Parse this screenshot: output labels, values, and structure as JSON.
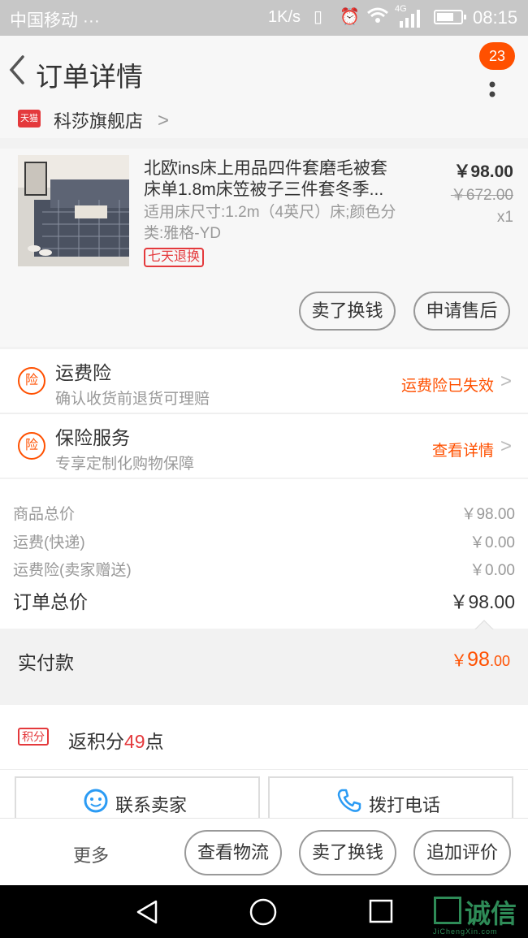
{
  "status_bar": {
    "carrier": "中国移动 ···",
    "speed": "1K/s",
    "network": "4G",
    "time": "08:15"
  },
  "header": {
    "title": "订单详情",
    "badge_count": "23"
  },
  "shop": {
    "logo_text": "天猫",
    "name": "科莎旗舰店"
  },
  "product": {
    "title": "北欧ins床上用品四件套磨毛被套床单1.8m床笠被子三件套冬季...",
    "sku": "适用床尺寸:1.2m（4英尺）床;颜色分类:雅格-YD",
    "tag": "七天退换",
    "price": "￥98.00",
    "original_price": "￥672.00",
    "quantity": "x1",
    "actions": [
      "卖了换钱",
      "申请售后"
    ]
  },
  "insurance": [
    {
      "title": "运费险",
      "subtitle": "确认收货前退货可理赔",
      "status": "运费险已失效",
      "icon_text": "险"
    },
    {
      "title": "保险服务",
      "subtitle": "专享定制化购物保障",
      "status": "查看详情",
      "icon_text": "险"
    }
  ],
  "summary": {
    "rows": [
      {
        "label": "商品总价",
        "value": "￥98.00"
      },
      {
        "label": "运费(快递)",
        "value": "￥0.00"
      },
      {
        "label": "运费险(卖家赠送)",
        "value": "￥0.00"
      }
    ],
    "total_label": "订单总价",
    "total_value": "￥98.00"
  },
  "payment": {
    "label": "实付款",
    "currency": "￥",
    "integer": "98",
    "decimal": ".00"
  },
  "points": {
    "tag": "积分",
    "prefix": "返积分",
    "amount": "49",
    "suffix": "点"
  },
  "contact": {
    "seller": "联系卖家",
    "phone": "拨打电话"
  },
  "bottom_bar": {
    "more": "更多",
    "actions": [
      "查看物流",
      "卖了换钱",
      "追加评价"
    ]
  },
  "watermark": {
    "main": "诚信",
    "sub": "JiChengXin.com"
  },
  "colors": {
    "accent": "#ff5000",
    "tmall_red": "#e4393c",
    "link_blue": "#2b9bf4"
  }
}
